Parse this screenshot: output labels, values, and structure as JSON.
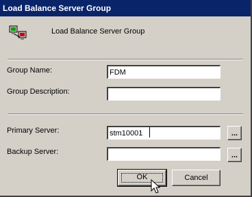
{
  "window": {
    "title": "Load Balance Server Group"
  },
  "header": {
    "icon": "server-group-icon",
    "text": "Load Balance Server Group"
  },
  "form": {
    "group_name": {
      "label": "Group Name:",
      "value": "FDM"
    },
    "group_description": {
      "label": "Group Description:",
      "value": ""
    },
    "primary_server": {
      "label": "Primary Server:",
      "value": "stm10001",
      "browse_label": "..."
    },
    "backup_server": {
      "label": "Backup Server:",
      "value": "",
      "browse_label": "..."
    }
  },
  "buttons": {
    "ok": "OK",
    "cancel": "Cancel"
  },
  "colors": {
    "titlebar": "#0a246a",
    "dialog_bg": "#d4d0c8"
  }
}
